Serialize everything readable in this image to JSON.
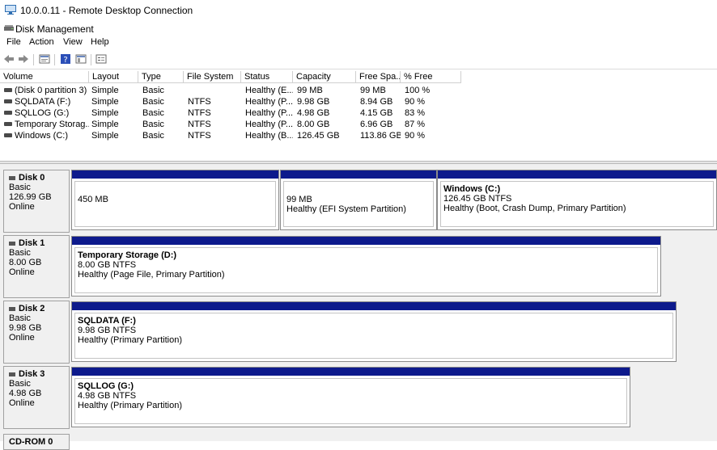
{
  "rdp": {
    "title": "10.0.0.11 - Remote Desktop Connection"
  },
  "app": {
    "title": "Disk Management"
  },
  "menu": [
    "File",
    "Action",
    "View",
    "Help"
  ],
  "toolbar": {
    "icons": [
      "back-icon",
      "forward-icon",
      "properties-icon",
      "help-icon",
      "console-icon",
      "console-tree-icon"
    ]
  },
  "volumes": {
    "columns": [
      "Volume",
      "Layout",
      "Type",
      "File System",
      "Status",
      "Capacity",
      "Free Spa...",
      "% Free"
    ],
    "rows": [
      [
        "(Disk 0 partition 3)",
        "Simple",
        "Basic",
        "",
        "Healthy (E...",
        "99 MB",
        "99 MB",
        "100 %"
      ],
      [
        "SQLDATA (F:)",
        "Simple",
        "Basic",
        "NTFS",
        "Healthy (P...",
        "9.98 GB",
        "8.94 GB",
        "90 %"
      ],
      [
        "SQLLOG (G:)",
        "Simple",
        "Basic",
        "NTFS",
        "Healthy (P...",
        "4.98 GB",
        "4.15 GB",
        "83 %"
      ],
      [
        "Temporary Storag...",
        "Simple",
        "Basic",
        "NTFS",
        "Healthy (P...",
        "8.00 GB",
        "6.96 GB",
        "87 %"
      ],
      [
        "Windows (C:)",
        "Simple",
        "Basic",
        "NTFS",
        "Healthy (B...",
        "126.45 GB",
        "113.86 GB",
        "90 %"
      ]
    ]
  },
  "disks": [
    {
      "name": "Disk 0",
      "type": "Basic",
      "size": "126.99 GB",
      "state": "Online",
      "partitions": [
        {
          "name": "",
          "detail": "450 MB",
          "status": ""
        },
        {
          "name": "",
          "detail": "99 MB",
          "status": "Healthy (EFI System Partition)"
        },
        {
          "name": "Windows  (C:)",
          "detail": "126.45 GB NTFS",
          "status": "Healthy (Boot, Crash Dump, Primary Partition)"
        }
      ]
    },
    {
      "name": "Disk 1",
      "type": "Basic",
      "size": "8.00 GB",
      "state": "Online",
      "partitions": [
        {
          "name": "Temporary Storage  (D:)",
          "detail": "8.00 GB NTFS",
          "status": "Healthy (Page File, Primary Partition)"
        }
      ]
    },
    {
      "name": "Disk 2",
      "type": "Basic",
      "size": "9.98 GB",
      "state": "Online",
      "partitions": [
        {
          "name": "SQLDATA  (F:)",
          "detail": "9.98 GB NTFS",
          "status": "Healthy (Primary Partition)"
        }
      ]
    },
    {
      "name": "Disk 3",
      "type": "Basic",
      "size": "4.98 GB",
      "state": "Online",
      "partitions": [
        {
          "name": "SQLLOG  (G:)",
          "detail": "4.98 GB NTFS",
          "status": "Healthy (Primary Partition)"
        }
      ]
    }
  ],
  "cdrom": {
    "name": "CD-ROM 0"
  },
  "colors": {
    "partition_band": "#0d1a8c",
    "graph_bg": "#f0f0f0"
  }
}
